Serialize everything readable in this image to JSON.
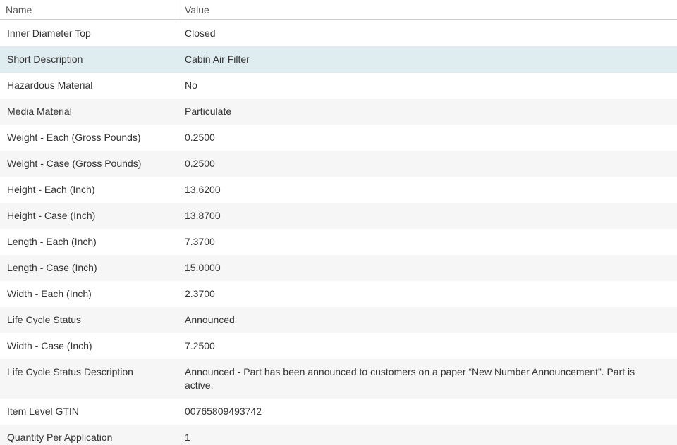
{
  "table": {
    "columns": [
      {
        "label": "Name"
      },
      {
        "label": "Value"
      }
    ],
    "rows": [
      {
        "name": "Inner Diameter Top",
        "value": "Closed",
        "highlight": false
      },
      {
        "name": "Short Description",
        "value": "Cabin Air Filter",
        "highlight": true
      },
      {
        "name": "Hazardous Material",
        "value": "No",
        "highlight": false
      },
      {
        "name": "Media Material",
        "value": "Particulate",
        "highlight": false
      },
      {
        "name": "Weight - Each (Gross Pounds)",
        "value": "0.2500",
        "highlight": false
      },
      {
        "name": "Weight - Case (Gross Pounds)",
        "value": "0.2500",
        "highlight": false
      },
      {
        "name": "Height - Each (Inch)",
        "value": "13.6200",
        "highlight": false
      },
      {
        "name": "Height - Case (Inch)",
        "value": "13.8700",
        "highlight": false
      },
      {
        "name": "Length - Each (Inch)",
        "value": "7.3700",
        "highlight": false
      },
      {
        "name": "Length - Case (Inch)",
        "value": "15.0000",
        "highlight": false
      },
      {
        "name": "Width - Each (Inch)",
        "value": "2.3700",
        "highlight": false
      },
      {
        "name": "Life Cycle Status",
        "value": "Announced",
        "highlight": false
      },
      {
        "name": "Width - Case (Inch)",
        "value": "7.2500",
        "highlight": false
      },
      {
        "name": "Life Cycle Status Description",
        "value": "Announced - Part has been announced to customers on a paper “New Number Announcement”. Part is active.",
        "highlight": false
      },
      {
        "name": "Item Level GTIN",
        "value": "00765809493742",
        "highlight": false
      },
      {
        "name": "Quantity Per Application",
        "value": "1",
        "highlight": false
      }
    ]
  },
  "colors": {
    "highlight_row": "#e0edf0",
    "stripe_row": "#f6f6f6",
    "header_text": "#555555",
    "body_text": "#333333",
    "header_border": "#cccccc",
    "column_divider": "#dddddd"
  }
}
